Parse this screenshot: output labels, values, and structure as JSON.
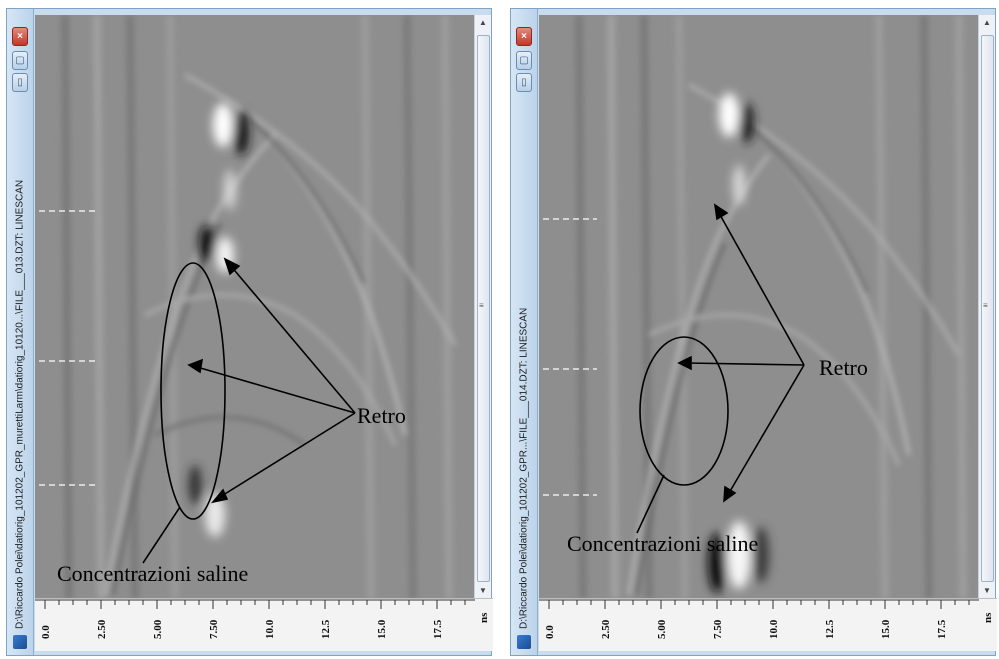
{
  "windows": [
    {
      "id": "left",
      "title": "D:\\Riccardo Polei\\datiorig_101202_GPR_murettiLarm\\datiorig_10120...\\FILE___013.DZT: LINESCAN",
      "controls": {
        "close": "×",
        "restore": "▢",
        "minimize": "▯"
      },
      "scroll_grip": "≡",
      "depth_ticks": [
        "0.0",
        "2.50",
        "5.00",
        "7.50",
        "10.0",
        "12.5",
        "15.0",
        "17.5"
      ],
      "unit": "ns",
      "annotations": {
        "retro": "Retro",
        "concentrazioni": "Concentrazioni saline"
      }
    },
    {
      "id": "right",
      "title": "D:\\Riccardo Polei\\datiorig_101202_GPR...\\FILE___014.DZT: LINESCAN",
      "controls": {
        "close": "×",
        "restore": "▢",
        "minimize": "▯"
      },
      "scroll_grip": "≡",
      "depth_ticks": [
        "0.0",
        "2.50",
        "5.00",
        "7.50",
        "10.0",
        "12.5",
        "15.0",
        "17.5"
      ],
      "unit": "ns",
      "annotations": {
        "retro": "Retro",
        "concentrazioni": "Concentrazioni saline"
      }
    }
  ]
}
